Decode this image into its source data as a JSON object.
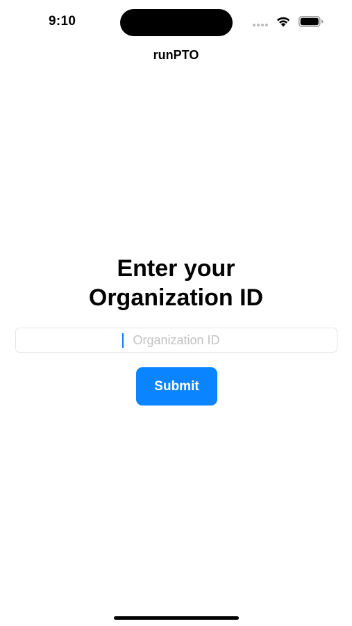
{
  "status_bar": {
    "time": "9:10",
    "icons": [
      "signal-icon",
      "wifi-icon",
      "battery-icon"
    ]
  },
  "nav": {
    "title": "runPTO"
  },
  "main": {
    "heading_line1": "Enter your",
    "heading_line2": "Organization ID",
    "input": {
      "value": "",
      "placeholder": "Organization ID"
    },
    "submit_label": "Submit"
  },
  "colors": {
    "accent": "#0a84ff",
    "placeholder": "#c2c2c2",
    "background": "#ffffff",
    "text": "#000000"
  }
}
